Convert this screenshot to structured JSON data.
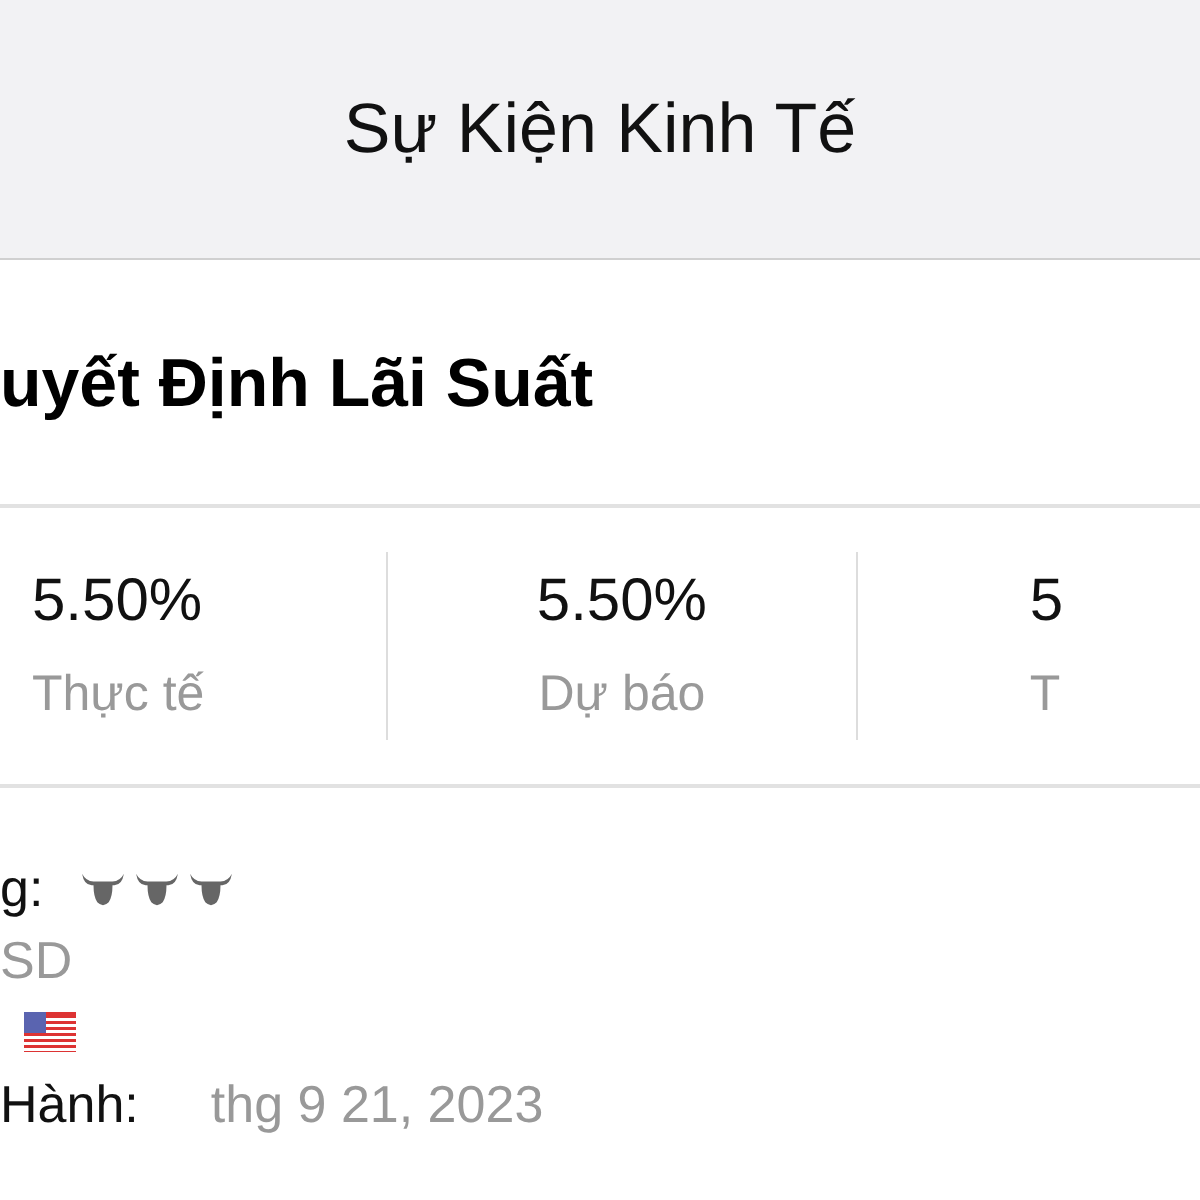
{
  "header": {
    "title": "Sự Kiện Kinh Tế"
  },
  "event": {
    "title": "uyết Định Lãi Suất"
  },
  "stats": [
    {
      "value": "5.50%",
      "label": "Thực tế"
    },
    {
      "value": "5.50%",
      "label": "Dự báo"
    },
    {
      "value": "5",
      "label": "T"
    }
  ],
  "details": {
    "importance": {
      "label": "g:",
      "stars": 3
    },
    "currency": "SD",
    "date": {
      "label": "Hành:",
      "value": "thg 9 21, 2023"
    }
  }
}
